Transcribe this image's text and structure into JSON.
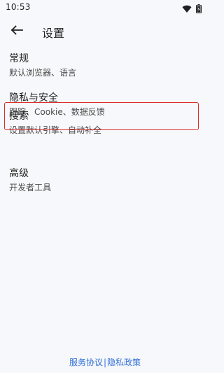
{
  "status_bar": {
    "time": "10:53",
    "icons": [
      "wifi-icon",
      "battery-icon"
    ]
  },
  "app_bar": {
    "back_icon": "arrow-left-icon",
    "title": "设置"
  },
  "settings": {
    "items": [
      {
        "title": "常规",
        "subtitle": "默认浏览器、语言"
      },
      {
        "title": "隐私与安全",
        "subtitle": "跟踪、Cookie、数据反馈"
      },
      {
        "title": "搜索",
        "subtitle": "设置默认引擎、自动补全",
        "highlighted": true
      },
      {
        "title": "高级",
        "subtitle": "开发者工具"
      }
    ]
  },
  "footer": {
    "terms_label": "服务协议",
    "separator": "|",
    "privacy_label": "隐私政策"
  },
  "colors": {
    "background": "#f7f8fb",
    "highlight": "#d9302b",
    "link": "#2f6fd6"
  }
}
